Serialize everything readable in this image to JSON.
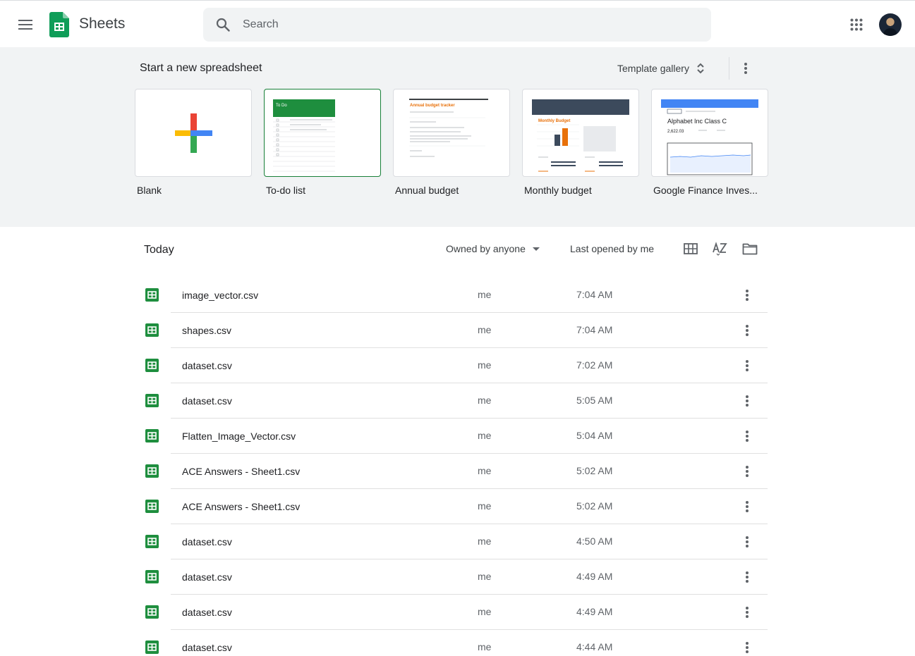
{
  "header": {
    "app_name": "Sheets",
    "search_placeholder": "Search"
  },
  "templates": {
    "heading": "Start a new spreadsheet",
    "gallery_label": "Template gallery",
    "cards": [
      {
        "label": "Blank"
      },
      {
        "label": "To-do list",
        "thumb_title": "To Do"
      },
      {
        "label": "Annual budget",
        "thumb_title": "Annual budget tracker"
      },
      {
        "label": "Monthly budget",
        "thumb_title": "Monthly Budget"
      },
      {
        "label": "Google Finance Inves...",
        "thumb_title": "Alphabet Inc Class C",
        "thumb_value": "2,622.03"
      }
    ]
  },
  "recent": {
    "section_label": "Today",
    "owner_filter": "Owned by anyone",
    "sort_label": "Last opened by me",
    "files": [
      {
        "name": "image_vector.csv",
        "owner": "me",
        "time": "7:04 AM"
      },
      {
        "name": "shapes.csv",
        "owner": "me",
        "time": "7:04 AM"
      },
      {
        "name": "dataset.csv",
        "owner": "me",
        "time": "7:02 AM"
      },
      {
        "name": "dataset.csv",
        "owner": "me",
        "time": "5:05 AM"
      },
      {
        "name": "Flatten_Image_Vector.csv",
        "owner": "me",
        "time": "5:04 AM"
      },
      {
        "name": "ACE Answers - Sheet1.csv",
        "owner": "me",
        "time": "5:02 AM"
      },
      {
        "name": "ACE Answers - Sheet1.csv",
        "owner": "me",
        "time": "5:02 AM"
      },
      {
        "name": "dataset.csv",
        "owner": "me",
        "time": "4:50 AM"
      },
      {
        "name": "dataset.csv",
        "owner": "me",
        "time": "4:49 AM"
      },
      {
        "name": "dataset.csv",
        "owner": "me",
        "time": "4:49 AM"
      },
      {
        "name": "dataset.csv",
        "owner": "me",
        "time": "4:44 AM"
      }
    ]
  },
  "colors": {
    "sheets_green": "#0f9d58",
    "file_icon_green": "#1e8e3e",
    "band_gray": "#f1f3f4",
    "plus_red": "#ea4335",
    "plus_yellow": "#fbbc04",
    "plus_green": "#34a853",
    "plus_blue": "#4285f4"
  },
  "icons": {
    "menu": "hamburger-icon",
    "search": "search-icon",
    "apps": "apps-grid-icon",
    "more": "more-vert-icon",
    "grid_view": "grid-view-icon",
    "sort": "sort-az-icon",
    "folder": "folder-icon",
    "dropdown": "caret-down-icon",
    "unfold": "unfold-icon"
  }
}
